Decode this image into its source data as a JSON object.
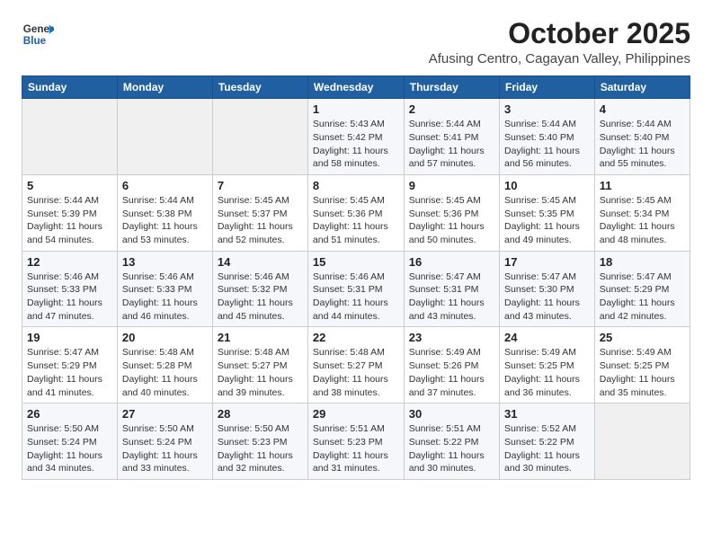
{
  "header": {
    "logo_general": "General",
    "logo_blue": "Blue",
    "title": "October 2025",
    "subtitle": "Afusing Centro, Cagayan Valley, Philippines"
  },
  "weekdays": [
    "Sunday",
    "Monday",
    "Tuesday",
    "Wednesday",
    "Thursday",
    "Friday",
    "Saturday"
  ],
  "weeks": [
    [
      {
        "day": "",
        "sunrise": "",
        "sunset": "",
        "daylight": ""
      },
      {
        "day": "",
        "sunrise": "",
        "sunset": "",
        "daylight": ""
      },
      {
        "day": "",
        "sunrise": "",
        "sunset": "",
        "daylight": ""
      },
      {
        "day": "1",
        "sunrise": "Sunrise: 5:43 AM",
        "sunset": "Sunset: 5:42 PM",
        "daylight": "Daylight: 11 hours and 58 minutes."
      },
      {
        "day": "2",
        "sunrise": "Sunrise: 5:44 AM",
        "sunset": "Sunset: 5:41 PM",
        "daylight": "Daylight: 11 hours and 57 minutes."
      },
      {
        "day": "3",
        "sunrise": "Sunrise: 5:44 AM",
        "sunset": "Sunset: 5:40 PM",
        "daylight": "Daylight: 11 hours and 56 minutes."
      },
      {
        "day": "4",
        "sunrise": "Sunrise: 5:44 AM",
        "sunset": "Sunset: 5:40 PM",
        "daylight": "Daylight: 11 hours and 55 minutes."
      }
    ],
    [
      {
        "day": "5",
        "sunrise": "Sunrise: 5:44 AM",
        "sunset": "Sunset: 5:39 PM",
        "daylight": "Daylight: 11 hours and 54 minutes."
      },
      {
        "day": "6",
        "sunrise": "Sunrise: 5:44 AM",
        "sunset": "Sunset: 5:38 PM",
        "daylight": "Daylight: 11 hours and 53 minutes."
      },
      {
        "day": "7",
        "sunrise": "Sunrise: 5:45 AM",
        "sunset": "Sunset: 5:37 PM",
        "daylight": "Daylight: 11 hours and 52 minutes."
      },
      {
        "day": "8",
        "sunrise": "Sunrise: 5:45 AM",
        "sunset": "Sunset: 5:36 PM",
        "daylight": "Daylight: 11 hours and 51 minutes."
      },
      {
        "day": "9",
        "sunrise": "Sunrise: 5:45 AM",
        "sunset": "Sunset: 5:36 PM",
        "daylight": "Daylight: 11 hours and 50 minutes."
      },
      {
        "day": "10",
        "sunrise": "Sunrise: 5:45 AM",
        "sunset": "Sunset: 5:35 PM",
        "daylight": "Daylight: 11 hours and 49 minutes."
      },
      {
        "day": "11",
        "sunrise": "Sunrise: 5:45 AM",
        "sunset": "Sunset: 5:34 PM",
        "daylight": "Daylight: 11 hours and 48 minutes."
      }
    ],
    [
      {
        "day": "12",
        "sunrise": "Sunrise: 5:46 AM",
        "sunset": "Sunset: 5:33 PM",
        "daylight": "Daylight: 11 hours and 47 minutes."
      },
      {
        "day": "13",
        "sunrise": "Sunrise: 5:46 AM",
        "sunset": "Sunset: 5:33 PM",
        "daylight": "Daylight: 11 hours and 46 minutes."
      },
      {
        "day": "14",
        "sunrise": "Sunrise: 5:46 AM",
        "sunset": "Sunset: 5:32 PM",
        "daylight": "Daylight: 11 hours and 45 minutes."
      },
      {
        "day": "15",
        "sunrise": "Sunrise: 5:46 AM",
        "sunset": "Sunset: 5:31 PM",
        "daylight": "Daylight: 11 hours and 44 minutes."
      },
      {
        "day": "16",
        "sunrise": "Sunrise: 5:47 AM",
        "sunset": "Sunset: 5:31 PM",
        "daylight": "Daylight: 11 hours and 43 minutes."
      },
      {
        "day": "17",
        "sunrise": "Sunrise: 5:47 AM",
        "sunset": "Sunset: 5:30 PM",
        "daylight": "Daylight: 11 hours and 43 minutes."
      },
      {
        "day": "18",
        "sunrise": "Sunrise: 5:47 AM",
        "sunset": "Sunset: 5:29 PM",
        "daylight": "Daylight: 11 hours and 42 minutes."
      }
    ],
    [
      {
        "day": "19",
        "sunrise": "Sunrise: 5:47 AM",
        "sunset": "Sunset: 5:29 PM",
        "daylight": "Daylight: 11 hours and 41 minutes."
      },
      {
        "day": "20",
        "sunrise": "Sunrise: 5:48 AM",
        "sunset": "Sunset: 5:28 PM",
        "daylight": "Daylight: 11 hours and 40 minutes."
      },
      {
        "day": "21",
        "sunrise": "Sunrise: 5:48 AM",
        "sunset": "Sunset: 5:27 PM",
        "daylight": "Daylight: 11 hours and 39 minutes."
      },
      {
        "day": "22",
        "sunrise": "Sunrise: 5:48 AM",
        "sunset": "Sunset: 5:27 PM",
        "daylight": "Daylight: 11 hours and 38 minutes."
      },
      {
        "day": "23",
        "sunrise": "Sunrise: 5:49 AM",
        "sunset": "Sunset: 5:26 PM",
        "daylight": "Daylight: 11 hours and 37 minutes."
      },
      {
        "day": "24",
        "sunrise": "Sunrise: 5:49 AM",
        "sunset": "Sunset: 5:25 PM",
        "daylight": "Daylight: 11 hours and 36 minutes."
      },
      {
        "day": "25",
        "sunrise": "Sunrise: 5:49 AM",
        "sunset": "Sunset: 5:25 PM",
        "daylight": "Daylight: 11 hours and 35 minutes."
      }
    ],
    [
      {
        "day": "26",
        "sunrise": "Sunrise: 5:50 AM",
        "sunset": "Sunset: 5:24 PM",
        "daylight": "Daylight: 11 hours and 34 minutes."
      },
      {
        "day": "27",
        "sunrise": "Sunrise: 5:50 AM",
        "sunset": "Sunset: 5:24 PM",
        "daylight": "Daylight: 11 hours and 33 minutes."
      },
      {
        "day": "28",
        "sunrise": "Sunrise: 5:50 AM",
        "sunset": "Sunset: 5:23 PM",
        "daylight": "Daylight: 11 hours and 32 minutes."
      },
      {
        "day": "29",
        "sunrise": "Sunrise: 5:51 AM",
        "sunset": "Sunset: 5:23 PM",
        "daylight": "Daylight: 11 hours and 31 minutes."
      },
      {
        "day": "30",
        "sunrise": "Sunrise: 5:51 AM",
        "sunset": "Sunset: 5:22 PM",
        "daylight": "Daylight: 11 hours and 30 minutes."
      },
      {
        "day": "31",
        "sunrise": "Sunrise: 5:52 AM",
        "sunset": "Sunset: 5:22 PM",
        "daylight": "Daylight: 11 hours and 30 minutes."
      },
      {
        "day": "",
        "sunrise": "",
        "sunset": "",
        "daylight": ""
      }
    ]
  ]
}
